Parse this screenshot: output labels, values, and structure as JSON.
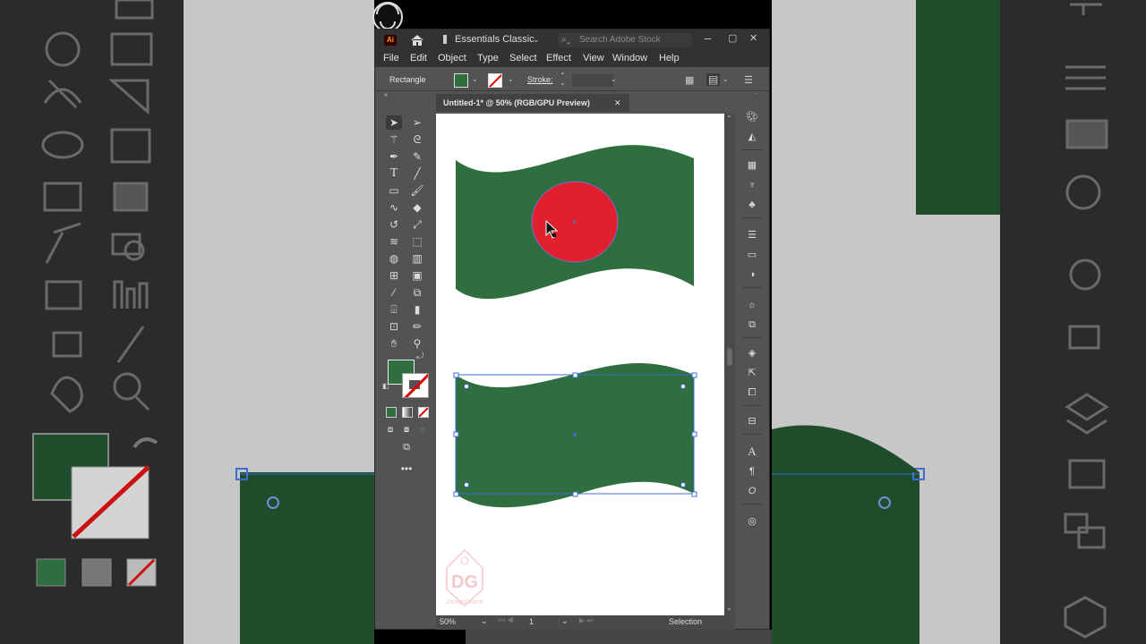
{
  "app": {
    "logo": "Ai",
    "workspace": "Essentials Classic",
    "search_placeholder": "Search Adobe Stock",
    "window_buttons": [
      "–",
      "▢",
      "✕"
    ]
  },
  "menu": [
    "File",
    "Edit",
    "Object",
    "Type",
    "Select",
    "Effect",
    "View",
    "Window",
    "Help"
  ],
  "control_bar": {
    "object_label": "Rectangle",
    "stroke_label": "Stroke:"
  },
  "document": {
    "tab_title": "Untitled-1* @ 50% (RGB/GPU Preview)",
    "close": "✕"
  },
  "status": {
    "zoom": "50%",
    "artboard_number": "1",
    "tool_name": "Selection"
  },
  "watermark": {
    "initials": "DG",
    "name": "DesignGhore"
  },
  "colors": {
    "flag_green": "#2f6e3f",
    "flag_red": "#e0202c",
    "selection_blue": "#3b6fd4"
  },
  "icons": {
    "tools": [
      "selection",
      "direct-selection",
      "magic-wand",
      "lasso",
      "pen",
      "curvature",
      "type",
      "line",
      "rectangle",
      "paintbrush",
      "shaper",
      "eraser",
      "rotate",
      "scale",
      "warp",
      "free-transform",
      "shape-builder",
      "perspective-grid",
      "mesh",
      "gradient",
      "eyedropper",
      "blend",
      "symbol-sprayer",
      "column-graph",
      "artboard",
      "slice",
      "hand",
      "zoom"
    ],
    "dock": [
      "color",
      "color-guide",
      "swatches",
      "brushes",
      "symbols",
      "stroke",
      "gradient",
      "transparency",
      "appearance",
      "graphic-styles",
      "layers",
      "asset-export",
      "artboards",
      "libraries",
      "character",
      "paragraph",
      "opentype",
      "navigator"
    ]
  }
}
